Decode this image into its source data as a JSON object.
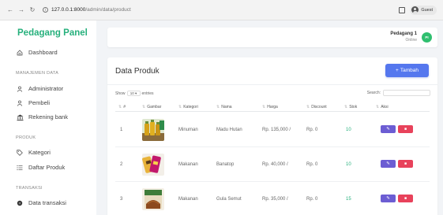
{
  "browser": {
    "url_host": "127.0.0.1:8000",
    "url_path": "/admin/data/product",
    "profile": "Guest"
  },
  "sidebar": {
    "brand": "Pedagang Panel",
    "dashboard": "Dashboard",
    "section_data": "MANAJEMEN DATA",
    "administrator": "Administrator",
    "pembeli": "Pembeli",
    "rekening": "Rekening bank",
    "section_produk": "PRODUK",
    "kategori": "Kategori",
    "daftar_produk": "Daftar Produk",
    "section_transaksi": "TRANSAKSI",
    "data_transaksi": "Data transaksi"
  },
  "topbar": {
    "user_name": "Pedagang 1",
    "user_status": "Online",
    "avatar_initials": "PI"
  },
  "card": {
    "title": "Data Produk",
    "add_label": "Tambah",
    "show_prefix": "Show",
    "show_value": "10",
    "show_suffix": "entries",
    "search_label": "Search:"
  },
  "table": {
    "headers": [
      "#",
      "Gambar",
      "Kategori",
      "Nama",
      "Harga",
      "Discount",
      "Stok",
      "Aksi"
    ],
    "rows": [
      {
        "no": "1",
        "kategori": "Minuman",
        "nama": "Madu Hutan",
        "harga": "Rp. 135,000 /",
        "discount": "Rp. 0",
        "stok": "10",
        "image": "honey-bottles"
      },
      {
        "no": "2",
        "kategori": "Makanan",
        "nama": "Banatop",
        "harga": "Rp. 40,000 /",
        "discount": "Rp. 0",
        "stok": "10",
        "image": "banana-chips"
      },
      {
        "no": "3",
        "kategori": "Makanan",
        "nama": "Gula Semut",
        "harga": "Rp. 35,000 /",
        "discount": "Rp. 0",
        "stok": "15",
        "image": "palm-sugar"
      }
    ]
  },
  "colors": {
    "brand": "#26b07c",
    "primary": "#5577ee",
    "edit": "#6c5dd3",
    "delete": "#e8425b"
  }
}
